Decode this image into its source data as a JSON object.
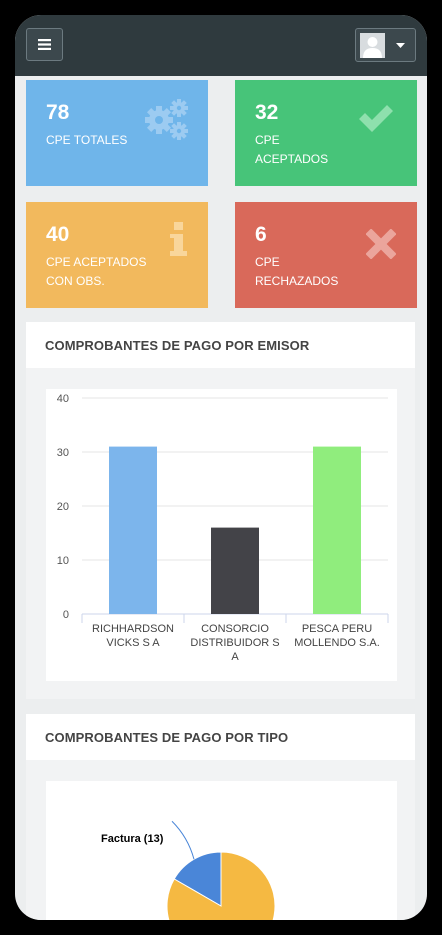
{
  "tiles": [
    {
      "value": "78",
      "line1": "CPE TOTALES",
      "line2": "",
      "icon": "gears-icon"
    },
    {
      "value": "32",
      "line1": "CPE",
      "line2": "ACEPTADOS",
      "icon": "check-icon"
    },
    {
      "value": "40",
      "line1": "CPE ACEPTADOS",
      "line2": "CON OBS.",
      "icon": "info-icon"
    },
    {
      "value": "6",
      "line1": "CPE",
      "line2": "RECHAZADOS",
      "icon": "close-icon"
    }
  ],
  "panels": {
    "emisor_title": "COMPROBANTES DE PAGO POR EMISOR",
    "tipo_title": "COMPROBANTES DE PAGO POR TIPO"
  },
  "chart_data": [
    {
      "type": "bar",
      "title": "",
      "categories": [
        [
          "RICHHARDSON",
          "VICKS S A"
        ],
        [
          "CONSORCIO",
          "DISTRIBUIDOR S",
          "A"
        ],
        [
          "PESCA PERU",
          "MOLLENDO S.A."
        ]
      ],
      "values": [
        31,
        16,
        31
      ],
      "colors": [
        "#7cb5ec",
        "#434348",
        "#90ed7d"
      ],
      "ylim": [
        0,
        40
      ],
      "yticks": [
        0,
        10,
        20,
        30,
        40
      ],
      "grid": true
    },
    {
      "type": "pie",
      "slices": [
        {
          "label": "Factura (13)",
          "value": 13,
          "color": "#4a86d8"
        },
        {
          "label": "",
          "value": 65,
          "color": "#f5b942"
        }
      ]
    }
  ]
}
